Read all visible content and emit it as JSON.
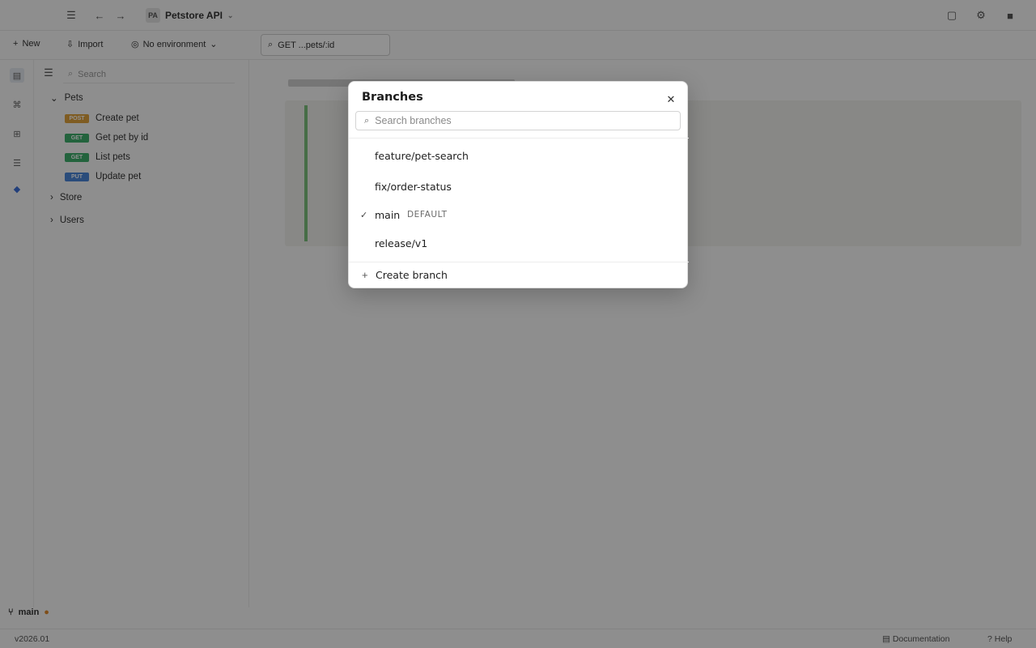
{
  "app": {
    "workspace_name": "Petstore API",
    "workspace_badge": "PA",
    "toolbar": {
      "new_label": "New",
      "import_label": "Import",
      "environment_label": "No environment"
    },
    "request_tab_label": "GET  ...pets/:id",
    "sidebar": {
      "search_placeholder": "Search",
      "folders": [
        {
          "label": "Pets"
        },
        {
          "label": "Store"
        },
        {
          "label": "Users"
        }
      ],
      "requests": [
        {
          "method": "POST",
          "label": "Create pet",
          "color": "#e0a23c"
        },
        {
          "method": "GET",
          "label": "Get pet by id",
          "color": "#3fae6c"
        },
        {
          "method": "GET",
          "label": "List pets",
          "color": "#3fae6c"
        },
        {
          "method": "PUT",
          "label": "Update pet",
          "color": "#4a86d8"
        }
      ]
    },
    "bottom_branch_label": "main",
    "status": {
      "version": "v2026.01",
      "docs_label": "Documentation",
      "help_label": "Help"
    }
  },
  "dialog": {
    "title": "Branches",
    "close_icon": "close-icon",
    "search": {
      "placeholder": "Search branches",
      "value": ""
    },
    "branches": [
      {
        "name": "feature/pet-search",
        "selected": false,
        "tag": ""
      },
      {
        "name": "fix/order-status",
        "selected": false,
        "tag": ""
      },
      {
        "name": "main",
        "selected": true,
        "tag": "DEFAULT"
      },
      {
        "name": "release/v1",
        "selected": false,
        "tag": ""
      }
    ],
    "check_glyph": "✓",
    "create_label": "Create branch",
    "create_glyph": "+"
  }
}
